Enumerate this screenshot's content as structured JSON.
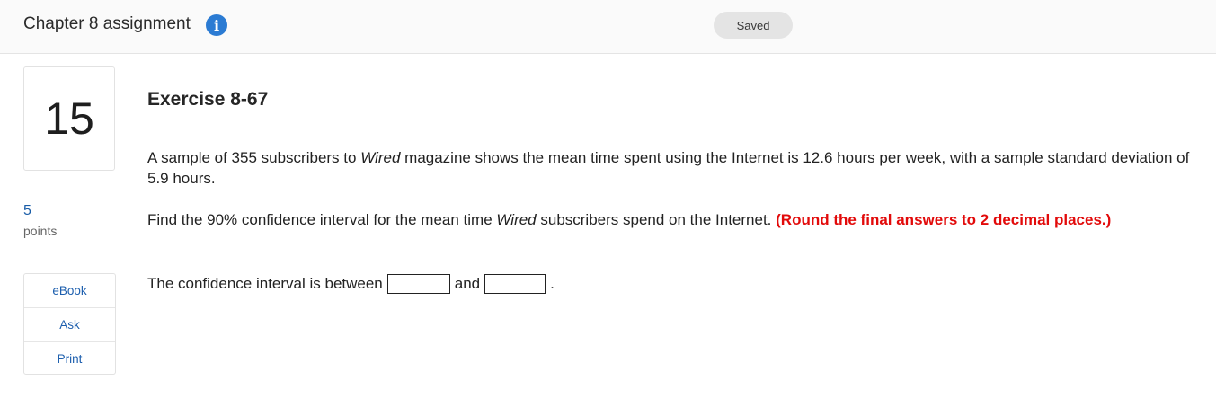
{
  "header": {
    "title": "Chapter 8 assignment",
    "info_icon": "i",
    "status": "Saved"
  },
  "question": {
    "number": "15",
    "points": "5",
    "points_label": "points"
  },
  "tools": [
    "eBook",
    "Ask",
    "Print"
  ],
  "exercise": {
    "title": "Exercise 8-67",
    "para1": {
      "a": "A sample of 355 subscribers to ",
      "b": "Wired",
      "c": " magazine shows the mean time spent using the Internet is 12.6 hours per week, with a sample standard deviation of 5.9 hours."
    },
    "para2": {
      "a": "Find the 90% confidence interval for the mean time ",
      "b": "Wired",
      "c": " subscribers spend on the Internet. ",
      "d": "(Round the final answers to 2 decimal places.)"
    },
    "answer": {
      "prefix": "The confidence interval is between",
      "middle": "and",
      "suffix": ".",
      "value1": "",
      "value2": ""
    }
  },
  "colors": {
    "accent": "#2b7bd3",
    "link": "#1d5fae",
    "emphasis": "#e20a0a"
  }
}
